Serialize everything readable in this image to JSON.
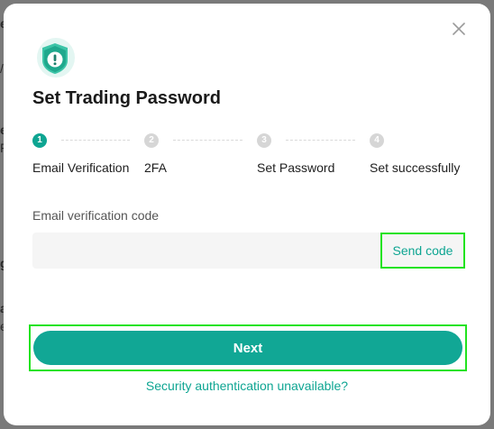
{
  "background": {
    "fragments": [
      "e",
      "/",
      "e",
      "F",
      "g",
      "a",
      "e"
    ]
  },
  "modal": {
    "title": "Set Trading Password",
    "header_icon": "shield-exclamation-icon",
    "close_icon": "close-icon",
    "steps": [
      {
        "number": "1",
        "label": "Email Verification",
        "state": "active"
      },
      {
        "number": "2",
        "label": "2FA",
        "state": "pending"
      },
      {
        "number": "3",
        "label": "Set Password",
        "state": "pending"
      },
      {
        "number": "4",
        "label": "Set successfully",
        "state": "pending"
      }
    ],
    "field": {
      "label": "Email verification code",
      "value": "",
      "placeholder": ""
    },
    "send_code_label": "Send code",
    "next_label": "Next",
    "security_link": "Security authentication unavailable?"
  },
  "colors": {
    "accent": "#0ea592",
    "button": "#11a795",
    "highlight": "#22e31f",
    "pending_step": "#d6d6d6"
  }
}
